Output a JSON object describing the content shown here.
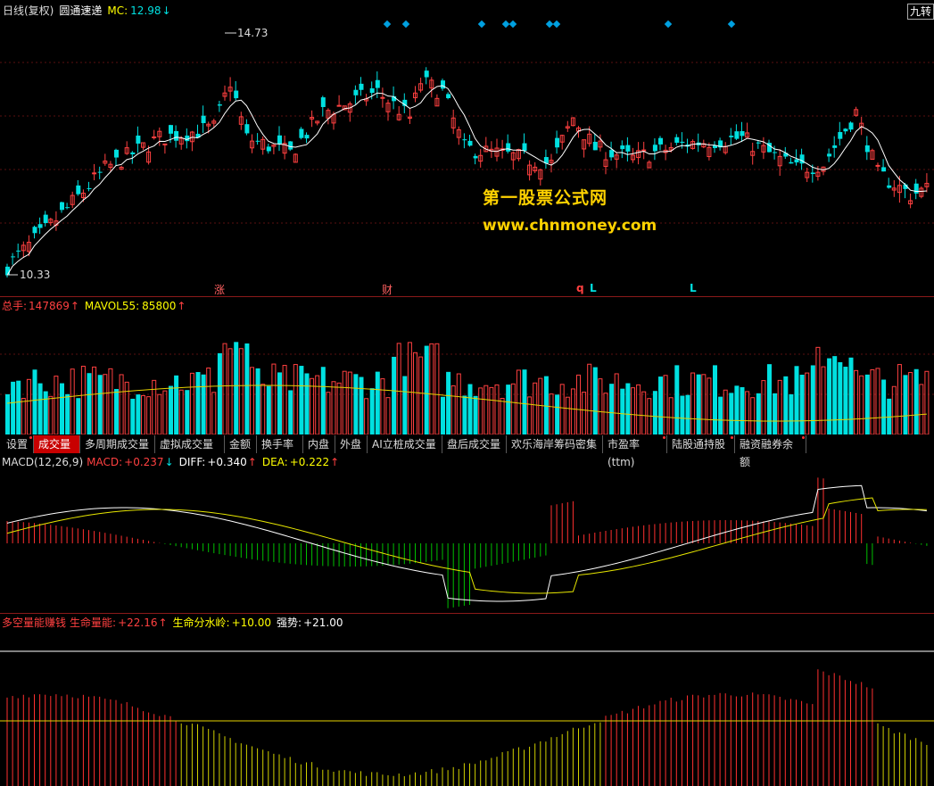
{
  "header": {
    "period": "日线(复权)",
    "stock_name": "圆通速递",
    "mc_label": "MC:",
    "mc_value": "12.98",
    "mc_arrow": "↓",
    "right_button": "九转"
  },
  "price_chart": {
    "high_label": "14.73",
    "low_label": "10.33",
    "markers": [
      "涨",
      "财",
      "q",
      "L",
      "L"
    ]
  },
  "watermark": {
    "line1": "第一股票公式网",
    "line2": "www.chnmoney.com"
  },
  "volume": {
    "total_label": "总手:",
    "total_value": "147869",
    "total_arrow": "↑",
    "mavol_label": "MAVOL55:",
    "mavol_value": "85800",
    "mavol_arrow": "↑"
  },
  "tabs": [
    {
      "label": "设置",
      "dot": true
    },
    {
      "label": "成交量",
      "dot": false
    },
    {
      "label": "多周期成交量",
      "dot": false
    },
    {
      "label": "虚拟成交量",
      "dot": false
    },
    {
      "label": "金额",
      "dot": false
    },
    {
      "label": "换手率",
      "dot": false
    },
    {
      "label": "内盘",
      "dot": false
    },
    {
      "label": "外盘",
      "dot": false
    },
    {
      "label": "AI立桩成交量",
      "dot": false
    },
    {
      "label": "盘后成交量",
      "dot": false
    },
    {
      "label": "欢乐海岸筹码密集",
      "dot": false
    },
    {
      "label": "市盈率(ttm)",
      "dot": true
    },
    {
      "label": "陆股通持股",
      "dot": true
    },
    {
      "label": "融资融券余额",
      "dot": true
    }
  ],
  "macd": {
    "name": "MACD(12,26,9)",
    "macd_label": "MACD:",
    "macd_value": "+0.237",
    "macd_arrow": "↓",
    "diff_label": "DIFF:",
    "diff_value": "+0.340",
    "diff_arrow": "↑",
    "dea_label": "DEA:",
    "dea_value": "+0.222",
    "dea_arrow": "↑"
  },
  "energy": {
    "name": "多空量能赚钱",
    "life_label": "生命量能:",
    "life_value": "+22.16",
    "life_arrow": "↑",
    "water_label": "生命分水岭:",
    "water_value": "+10.00",
    "strong_label": "强势:",
    "strong_value": "+21.00"
  },
  "colors": {
    "up": "#ff4040",
    "down": "#00e0e0",
    "ma": "#ffffff",
    "mavol": "#e6d200",
    "macd_pos": "#ff3030",
    "macd_neg": "#00c000",
    "energy_high": "#ff3030",
    "energy_low": "#d0d000",
    "background": "#000000"
  }
}
